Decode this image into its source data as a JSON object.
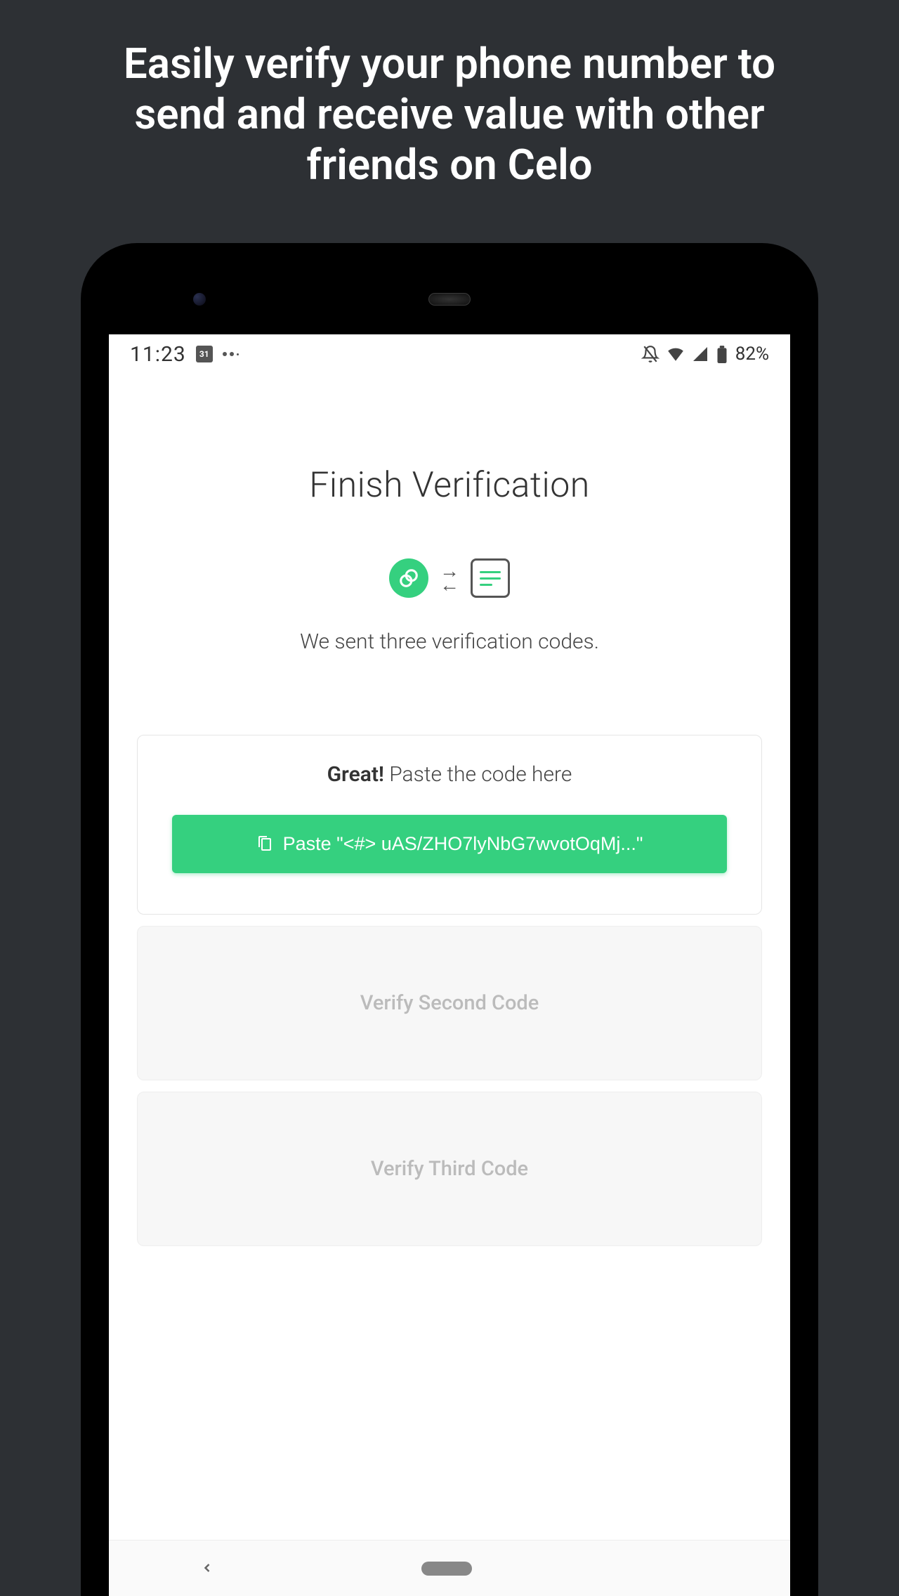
{
  "promo": {
    "headline": "Easily verify your phone number to send and receive value with other friends on Celo"
  },
  "statusBar": {
    "time": "11:23",
    "calendar": "31",
    "battery": "82%"
  },
  "screen": {
    "title": "Finish Verification",
    "subtitle": "We sent three verification codes.",
    "card1": {
      "promptPrefix": "Great!",
      "promptText": " Paste the code here",
      "pasteLabel": "Paste \"<#> uAS/ZHO7lyNbG7wvotOqMj...\""
    },
    "card2": {
      "label": "Verify Second Code"
    },
    "card3": {
      "label": "Verify Third Code"
    }
  }
}
